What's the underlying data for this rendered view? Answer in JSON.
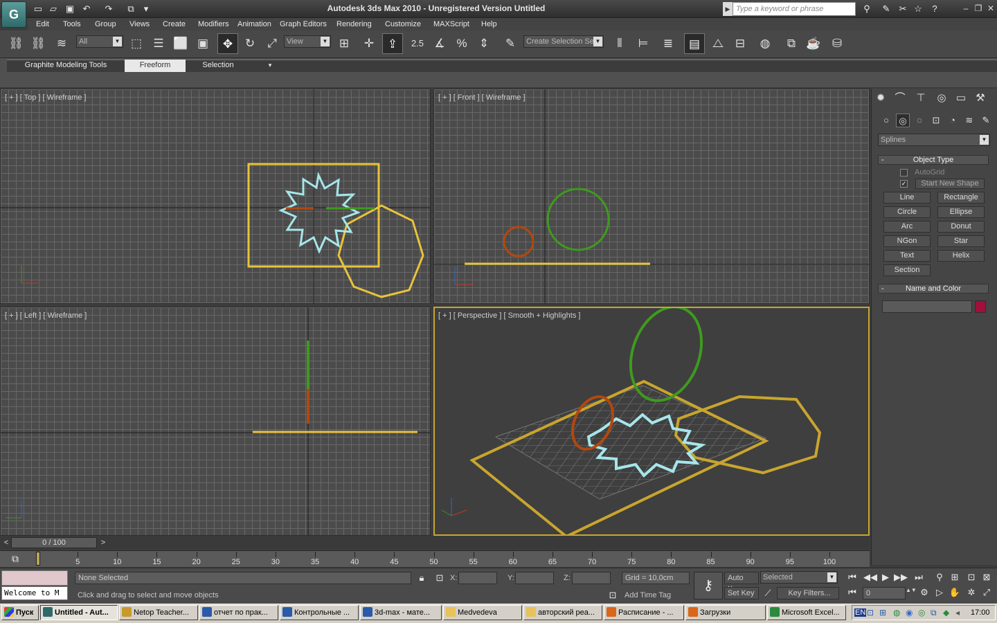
{
  "app": {
    "title": "Autodesk 3ds Max  2010   -  Unregistered Version    Untitled",
    "logo_text": "G",
    "search_placeholder": "Type a keyword or phrase"
  },
  "menu": [
    "Edit",
    "Tools",
    "Group",
    "Views",
    "Create",
    "Modifiers",
    "Animation",
    "Graph Editors",
    "Rendering",
    "Customize",
    "MAXScript",
    "Help"
  ],
  "toolbar": {
    "selection_filter": "All",
    "ref_coord": "View",
    "snap_angle": "2.5",
    "selection_set_placeholder": "Create Selection Se"
  },
  "ribbon": {
    "tabs": [
      "Graphite Modeling Tools",
      "Freeform",
      "Selection"
    ],
    "selected_tab": "Freeform"
  },
  "viewports": {
    "top": "[ + ] [ Top ] [ Wireframe ]",
    "front": "[ + ] [ Front ] [ Wireframe ]",
    "left": "[ + ] [ Left ] [ Wireframe ]",
    "perspective": "[ + ] [ Perspective ] [ Smooth + Highlights ]"
  },
  "command_panel": {
    "category": "Splines",
    "object_type_header": "Object Type",
    "autogrid_label": "AutoGrid",
    "start_new_shape_label": "Start New Shape",
    "start_new_shape_checked": true,
    "buttons": [
      "Line",
      "Rectangle",
      "Circle",
      "Ellipse",
      "Arc",
      "Donut",
      "NGon",
      "Star",
      "Text",
      "Helix",
      "Section"
    ],
    "name_color_header": "Name and Color",
    "object_color": "#a0103a"
  },
  "timeline": {
    "slider_text": "0 / 100",
    "ticks": [
      "5",
      "10",
      "15",
      "20",
      "25",
      "30",
      "35",
      "40",
      "45",
      "50",
      "55",
      "60",
      "65",
      "70",
      "75",
      "80",
      "85",
      "90",
      "95",
      "100"
    ]
  },
  "status": {
    "maxscript_listener": "Welcome to M",
    "selection": "None Selected",
    "prompt": "Click and drag to select and move objects",
    "x_label": "X:",
    "y_label": "Y:",
    "z_label": "Z:",
    "grid": "Grid = 10,0cm",
    "add_time_tag": "Add Time Tag",
    "auto_key": "Auto Key",
    "set_key": "Set Key",
    "key_mode": "Selected",
    "key_filters": "Key Filters...",
    "frame": "0"
  },
  "taskbar": {
    "start": "Пуск",
    "tasks": [
      {
        "label": "Untitled - Aut...",
        "color": "#2f6a6a"
      },
      {
        "label": "Netop Teacher...",
        "color": "#c89a2c"
      },
      {
        "label": "отчет по прак...",
        "color": "#2a5aa8"
      },
      {
        "label": "Контрольные ...",
        "color": "#2a5aa8"
      },
      {
        "label": "3d-max - мате...",
        "color": "#2a5aa8"
      },
      {
        "label": "Medvedeva",
        "color": "#e8c25a"
      },
      {
        "label": "авторский реа...",
        "color": "#e8c25a"
      },
      {
        "label": "Расписание - ...",
        "color": "#d9661a"
      },
      {
        "label": "Загрузки",
        "color": "#d9661a"
      },
      {
        "label": "Microsoft Excel...",
        "color": "#2b8a3e"
      }
    ],
    "lang": "EN",
    "clock": "17:00"
  },
  "colors": {
    "rectangle": "#e8c33c",
    "star": "#a6e6ea",
    "ngon": "#e8c33c",
    "circle_green": "#3f9a1e",
    "circle_orange": "#b2480f",
    "active_border": "#c7a62f"
  }
}
